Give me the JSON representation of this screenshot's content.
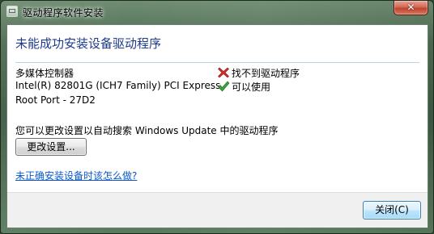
{
  "window": {
    "title": "驱动程序软件安装",
    "close_glyph": "✕"
  },
  "main": {
    "heading": "未能成功安装设备驱动程序",
    "devices": [
      {
        "name": "多媒体控制器",
        "status": "找不到驱动程序",
        "status_icon": "error-x-icon",
        "status_color": "#d0302b"
      },
      {
        "name_line1": "Intel(R) 82801G (ICH7 Family) PCI Express",
        "name_line2": "Root Port - 27D2",
        "status": "可以使用",
        "status_icon": "checkmark-icon",
        "status_color": "#3aa33a"
      }
    ],
    "hint": "您可以更改设置以自动搜索 Windows Update 中的驱动程序",
    "change_settings_button": "更改设置...",
    "help_link": "未正确安装设备时该怎么做?"
  },
  "footer": {
    "close_button": "关闭(C)"
  }
}
